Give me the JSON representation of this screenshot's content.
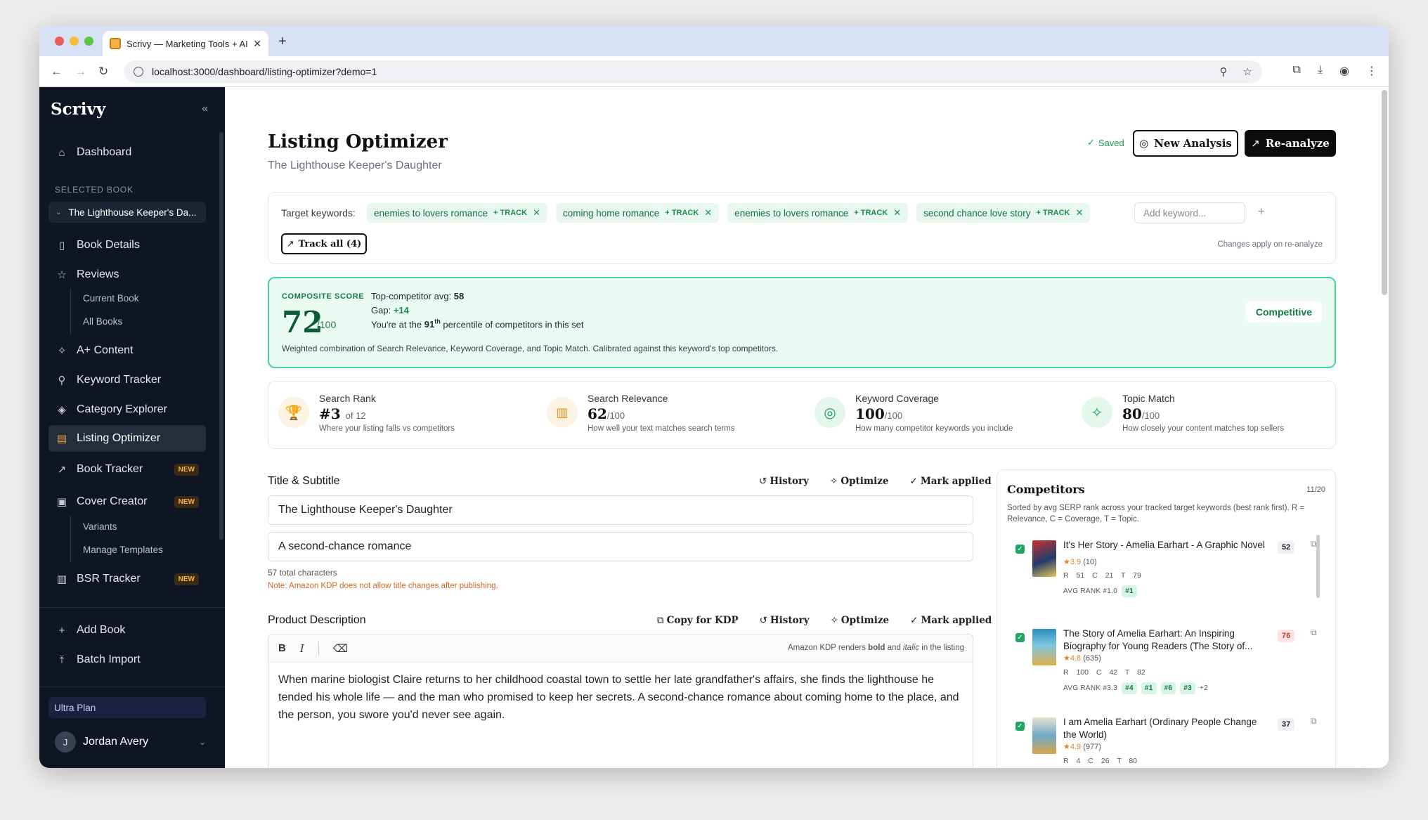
{
  "browser": {
    "tab_title": "Scrivy — Marketing Tools + AI",
    "url": "localhost:3000/dashboard/listing-optimizer?demo=1"
  },
  "sidebar": {
    "brand": "Scrivy",
    "dashboard": "Dashboard",
    "selected_book_label": "SELECTED BOOK",
    "selected_book": "The Lighthouse Keeper's Da...",
    "book_details": "Book Details",
    "reviews": "Reviews",
    "reviews_sub": [
      "Current Book",
      "All Books"
    ],
    "aplus": "A+ Content",
    "keyword_tracker": "Keyword Tracker",
    "category_explorer": "Category Explorer",
    "listing_optimizer": "Listing Optimizer",
    "book_tracker": "Book Tracker",
    "cover_creator": "Cover Creator",
    "cover_sub": [
      "Variants",
      "Manage Templates"
    ],
    "bsr_tracker": "BSR Tracker",
    "new_badge": "NEW",
    "add_book": "Add Book",
    "batch_import": "Batch Import",
    "plan": "Ultra Plan",
    "user_initial": "J",
    "user_name": "Jordan Avery"
  },
  "header": {
    "title": "Listing Optimizer",
    "subtitle": "The Lighthouse Keeper's Daughter",
    "saved": "Saved",
    "new_analysis": "New Analysis",
    "reanalyze": "Re-analyze"
  },
  "keywords": {
    "label": "Target keywords:",
    "chips": [
      {
        "text": "enemies to lovers romance",
        "track": "+ TRACK"
      },
      {
        "text": "coming home romance",
        "track": "+ TRACK"
      },
      {
        "text": "enemies to lovers romance",
        "track": "+ TRACK"
      },
      {
        "text": "second chance love story",
        "track": "+ TRACK"
      }
    ],
    "add_placeholder": "Add keyword...",
    "track_all": "Track all (4)",
    "note": "Changes apply on re-analyze"
  },
  "composite": {
    "label": "COMPOSITE SCORE",
    "score": "72",
    "denominator": "/100",
    "avg_label": "Top-competitor avg:",
    "avg_value": "58",
    "gap_label": "Gap:",
    "gap_value": "+14",
    "percentile_pre": "You're at the",
    "percentile_num": "91",
    "percentile_suffix": "th",
    "percentile_post": "percentile of competitors in this set",
    "description": "Weighted combination of Search Relevance, Keyword Coverage, and Topic Match. Calibrated against this keyword's top competitors.",
    "status": "Competitive"
  },
  "metrics": [
    {
      "title": "Search Rank",
      "value": "#3",
      "unit": "of 12",
      "desc": "Where your listing falls vs competitors"
    },
    {
      "title": "Search Relevance",
      "value": "62",
      "unit": "/100",
      "desc": "How well your text matches search terms"
    },
    {
      "title": "Keyword Coverage",
      "value": "100",
      "unit": "/100",
      "desc": "How many competitor keywords you include"
    },
    {
      "title": "Topic Match",
      "value": "80",
      "unit": "/100",
      "desc": "How closely your content matches top sellers"
    }
  ],
  "title_section": {
    "heading": "Title & Subtitle",
    "history": "History",
    "optimize": "Optimize",
    "mark_applied": "Mark applied",
    "title_value": "The Lighthouse Keeper's Daughter",
    "subtitle_value": "A second-chance romance",
    "char_count": "57 total characters",
    "note": "Note: Amazon KDP does not allow title changes after publishing."
  },
  "description_section": {
    "heading": "Product Description",
    "copy_kdp": "Copy for KDP",
    "history": "History",
    "optimize": "Optimize",
    "mark_applied": "Mark applied",
    "toolbar_note_pre": "Amazon KDP renders",
    "toolbar_note_bold": "bold",
    "toolbar_note_and": "and",
    "toolbar_note_italic": "italic",
    "toolbar_note_post": "in the listing",
    "body": "When marine biologist Claire returns to her childhood coastal town to settle her late grandfather's affairs, she finds the lighthouse he tended his whole life — and the man who promised to keep her secrets. A second-chance romance about coming home to the place, and the person, you swore you'd never see again."
  },
  "competitors": {
    "title": "Competitors",
    "count": "11/20",
    "desc": "Sorted by avg SERP rank across your tracked target keywords (best rank first). R = Relevance, C = Coverage, T = Topic.",
    "items": [
      {
        "title": "It's Her Story - Amelia Earhart - A Graphic Novel",
        "score": "52",
        "rating": "3.9",
        "reviews": "(10)",
        "r": "R 51",
        "c": "C 21",
        "t": "T 79",
        "avg": "AVG RANK #1.0",
        "ranks": [
          "#1"
        ],
        "more": ""
      },
      {
        "title": "The Story of Amelia Earhart: An Inspiring Biography for Young Readers (The Story of...",
        "score": "76",
        "rating": "4.8",
        "reviews": "(635)",
        "r": "R 100",
        "c": "C 42",
        "t": "T 82",
        "avg": "AVG RANK #3.3",
        "ranks": [
          "#4",
          "#1",
          "#6",
          "#3"
        ],
        "more": "+2"
      },
      {
        "title": "I am Amelia Earhart (Ordinary People Change the World)",
        "score": "37",
        "rating": "4.9",
        "reviews": "(977)",
        "r": "R 4",
        "c": "C 26",
        "t": "T 80",
        "avg": "",
        "ranks": [],
        "more": ""
      }
    ]
  }
}
